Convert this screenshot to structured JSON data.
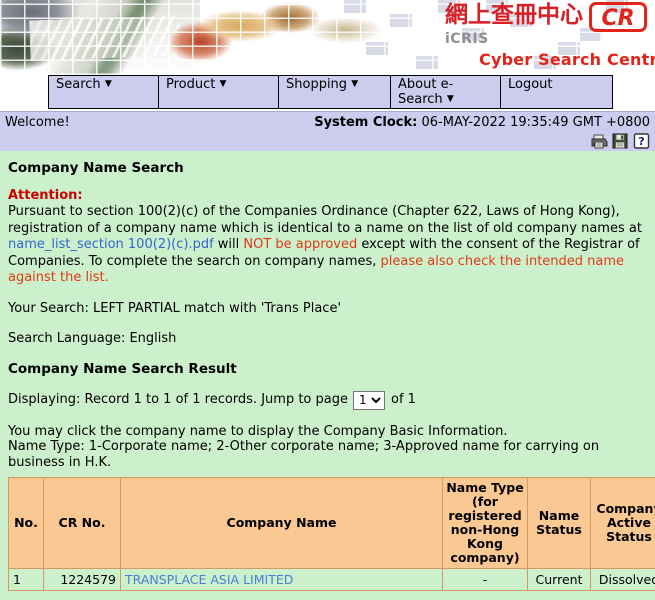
{
  "banner": {
    "chinese_title": "網上查冊中心",
    "logo_text": "CR",
    "system_name": "iCRIS",
    "subtitle": "Cyber Search Centre"
  },
  "nav": {
    "items": [
      {
        "label": "Search",
        "has_caret": true
      },
      {
        "label": "Product",
        "has_caret": true
      },
      {
        "label": "Shopping",
        "has_caret": true
      },
      {
        "label": "About e-Search",
        "has_caret": true
      },
      {
        "label": "Logout",
        "has_caret": false
      }
    ]
  },
  "statusbar": {
    "welcome": "Welcome!",
    "clock_label": "System Clock:",
    "clock_value": "06-MAY-2022 19:35:49 GMT +0800",
    "icons": [
      "print-icon",
      "save-icon",
      "help-icon"
    ]
  },
  "main": {
    "page_title": "Company Name Search",
    "attention_label": "Attention:",
    "attention_part1": "Pursuant to section 100(2)(c) of the Companies Ordinance (Chapter 622, Laws of Hong Kong), registration of a company name which is identical to a name on the list of old company names at ",
    "attention_link": "name_list_section 100(2)(c).pdf",
    "attention_part2": " will ",
    "attention_red1": "NOT be approved",
    "attention_part3": " except with the consent of the Registrar of Companies. To complete the search on company names, ",
    "attention_red2": "please also check the intended name against the list.",
    "your_search": "Your Search: LEFT PARTIAL match with 'Trans Place'",
    "search_language": "Search Language: English",
    "result_title": "Company Name Search Result",
    "displaying_prefix": "Displaying: Record 1 to 1 of 1 records. Jump to page",
    "page_selected": "1",
    "page_options": [
      "1"
    ],
    "of_label": "of",
    "total_pages": "1",
    "note_line1": "You may click the company name to display the Company Basic Information.",
    "note_line2": "Name Type: 1-Corporate name; 2-Other corporate name; 3-Approved name for carrying on business in H.K."
  },
  "results_table": {
    "columns": [
      "No.",
      "CR No.",
      "Company Name",
      "Name Type (for registered non-Hong Kong company)",
      "Name Status",
      "Company Active Status"
    ],
    "rows": [
      {
        "no": "1",
        "cr_no": "1224579",
        "company_name": "TRANSPLACE ASIA LIMITED",
        "name_type": "-",
        "name_status": "Current",
        "company_active_status": "Dissolved"
      }
    ]
  },
  "colors": {
    "nav_bg": "#ccccee",
    "main_bg": "#ccf0cc",
    "table_header_bg": "#fac893",
    "link_blue": "#3366cc",
    "accent_red": "#e2231a",
    "warning_red": "#cc0000"
  }
}
